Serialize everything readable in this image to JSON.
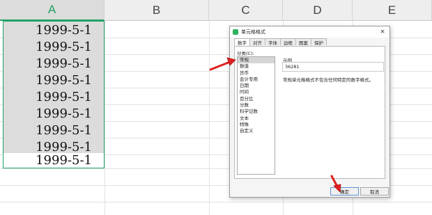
{
  "spreadsheet": {
    "columns": [
      "A",
      "B",
      "C",
      "D",
      "E"
    ],
    "selected_column": "A",
    "cells": [
      "1999-5-1",
      "1999-5-1",
      "1999-5-1",
      "1999-5-1",
      "1999-5-1",
      "1999-5-1",
      "1999-5-1",
      "1999-5-1",
      "1999-5-1"
    ]
  },
  "dialog": {
    "title": "单元格格式",
    "close_label": "×",
    "tabs": [
      "数字",
      "对齐",
      "字体",
      "边框",
      "图案",
      "保护"
    ],
    "category_label": "分类(C):",
    "categories": [
      "常规",
      "数值",
      "货币",
      "会计专用",
      "日期",
      "时间",
      "百分比",
      "分数",
      "科学记数",
      "文本",
      "特殊",
      "自定义"
    ],
    "selected_category": "常规",
    "sample_label": "示例",
    "sample_value": "36281",
    "description": "常规单元格格式不包含任何特定的数字格式。",
    "ok_label": "确定",
    "cancel_label": "取消"
  },
  "colors": {
    "selection": "#21a366",
    "annotation_arrow": "#e02020"
  }
}
